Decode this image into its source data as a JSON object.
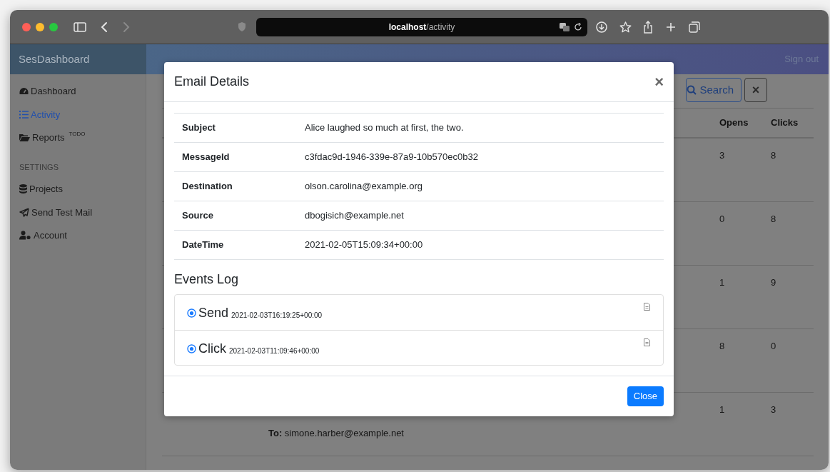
{
  "browser": {
    "url_host": "localhost",
    "url_path": "/activity",
    "back_enabled": true,
    "forward_enabled": false
  },
  "app": {
    "brand": "SesDashboard",
    "sign_out": "Sign out"
  },
  "sidebar": {
    "items": [
      {
        "label": "Dashboard",
        "selected": false
      },
      {
        "label": "Activity",
        "selected": true
      },
      {
        "label": "Reports",
        "sup": "TODO",
        "selected": false
      }
    ],
    "section_title": "SETTINGS",
    "settings_items": [
      {
        "label": "Projects",
        "selected": false
      },
      {
        "label": "Send Test Mail",
        "selected": false
      },
      {
        "label": "Account",
        "selected": false
      }
    ]
  },
  "toolbar": {
    "search_button": "Search",
    "clear_button": "×"
  },
  "table": {
    "columns": [
      "Opens",
      "Clicks"
    ],
    "rows": [
      {
        "opens": "3",
        "clicks": "8"
      },
      {
        "opens": "0",
        "clicks": "8"
      },
      {
        "opens": "1",
        "clicks": "9"
      },
      {
        "opens": "8",
        "clicks": "0"
      },
      {
        "opens": "1",
        "clicks": "3",
        "to_label": "To:",
        "to": "simone.harber@example.net"
      }
    ]
  },
  "modal": {
    "title": "Email Details",
    "close": "×",
    "details": [
      {
        "label": "Subject",
        "value": "Alice laughed so much at first, the two."
      },
      {
        "label": "MessageId",
        "value": "c3fdac9d-1946-339e-87a9-10b570ec0b32"
      },
      {
        "label": "Destination",
        "value": "olson.carolina@example.org"
      },
      {
        "label": "Source",
        "value": "dbogisich@example.net"
      },
      {
        "label": "DateTime",
        "value": "2021-02-05T15:09:34+00:00"
      }
    ],
    "events_title": "Events Log",
    "events": [
      {
        "name": "Send",
        "time": "2021-02-03T16:19:25+00:00"
      },
      {
        "name": "Click",
        "time": "2021-02-03T11:09:46+00:00"
      }
    ],
    "footer_button": "Close"
  }
}
